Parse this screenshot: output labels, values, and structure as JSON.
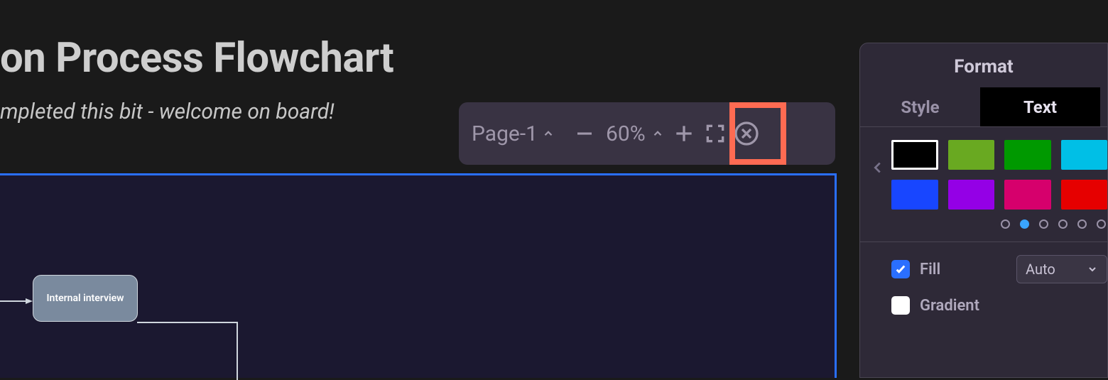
{
  "header": {
    "title_fragment": "on Process Flowchart",
    "subtitle_fragment": "mpleted this bit - welcome on board!"
  },
  "toolbar": {
    "page_label": "Page-1",
    "zoom_percent": "60%"
  },
  "canvas": {
    "node_label": "Internal interview"
  },
  "format_panel": {
    "title": "Format",
    "tabs": {
      "style": "Style",
      "text": "Text"
    },
    "colors": {
      "row1": [
        "#000000",
        "#69a921",
        "#009900",
        "#00bfe6"
      ],
      "row2": [
        "#1846ff",
        "#9400e6",
        "#d6006c",
        "#e60000"
      ]
    },
    "page_dots": {
      "count": 6,
      "active_index": 1
    },
    "fill": {
      "label": "Fill",
      "checked": true,
      "dropdown_value": "Auto"
    },
    "gradient": {
      "label": "Gradient",
      "checked": false
    }
  }
}
